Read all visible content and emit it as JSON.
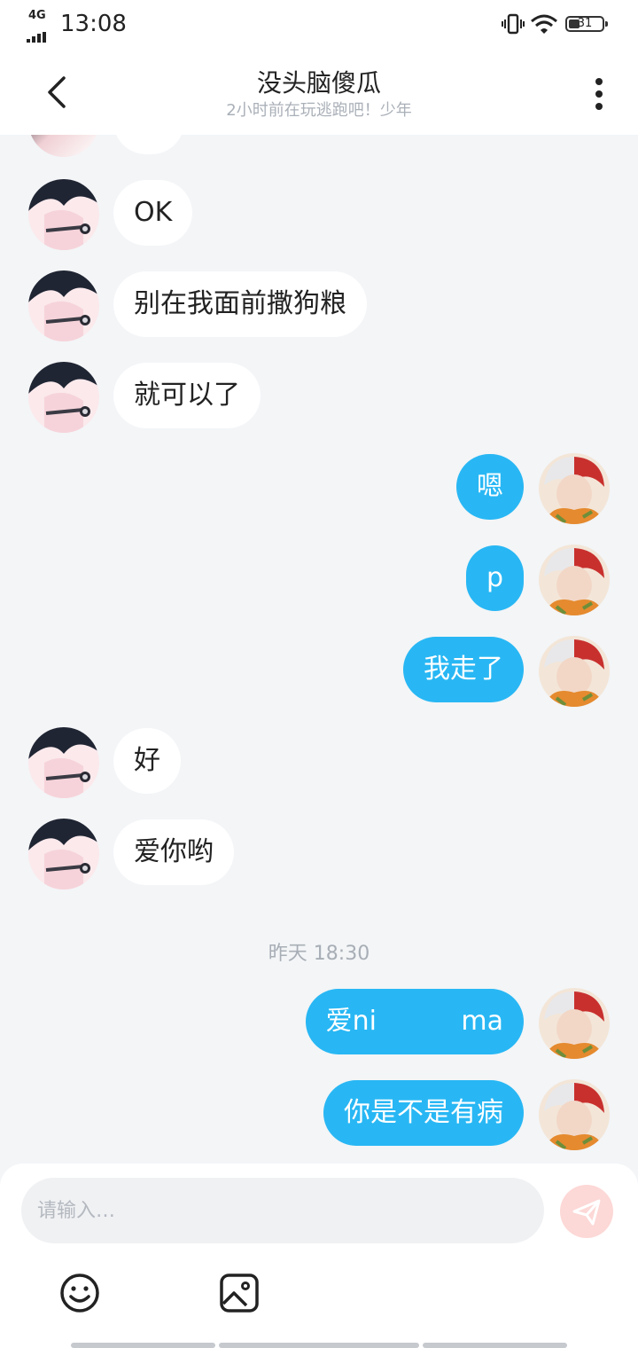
{
  "status_bar": {
    "network": "4G",
    "time": "13:08",
    "battery": "31"
  },
  "header": {
    "title": "没头脑傻瓜",
    "subtitle": "2小时前在玩逃跑吧！少年"
  },
  "messages": [
    {
      "side": "in",
      "text": "OK"
    },
    {
      "side": "in",
      "text": "别在我面前撒狗粮"
    },
    {
      "side": "in",
      "text": "就可以了"
    },
    {
      "side": "out",
      "text": "嗯"
    },
    {
      "side": "out",
      "text": "p"
    },
    {
      "side": "out",
      "text": "我走了"
    },
    {
      "side": "in",
      "text": "好"
    },
    {
      "side": "in",
      "text": "爱你哟"
    },
    {
      "time_separator": "昨天 18:30"
    },
    {
      "side": "out",
      "text": "爱ni          ma"
    },
    {
      "side": "out",
      "text": "你是不是有病"
    }
  ],
  "input": {
    "placeholder": "请输入…"
  },
  "colors": {
    "outgoing_bubble": "#28b7f4",
    "incoming_bubble": "#ffffff",
    "background": "#f3f5f7",
    "send_button": "#fcd8d6"
  },
  "icons": [
    "back-arrow-icon",
    "more-vertical-icon",
    "send-icon",
    "emoji-icon",
    "image-icon"
  ]
}
